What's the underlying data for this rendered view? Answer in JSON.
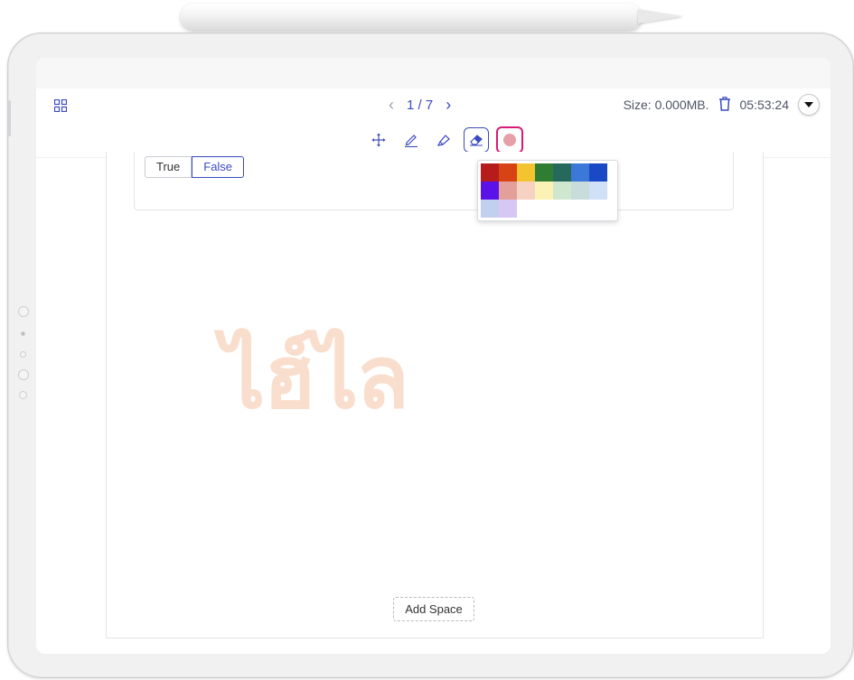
{
  "toolbar": {
    "page_indicator": "1 / 7",
    "size_text": "Size: 0.000MB.",
    "time": "05:53:24",
    "current_color": "#e8a0a8"
  },
  "icons": {
    "grid": "grid-icon",
    "prev": "chevron-left-icon",
    "next": "chevron-right-icon",
    "trash": "trash-icon",
    "dropdown": "caret-down-icon",
    "move": "move-icon",
    "pen": "pen-icon",
    "highlighter": "highlighter-icon",
    "eraser": "eraser-icon"
  },
  "palette": {
    "colors": [
      "#b71c1c",
      "#d84315",
      "#f4c430",
      "#2e7d32",
      "#26695c",
      "#3b78d8",
      "#1a49c5",
      "#5b12e8",
      "#e3a09a",
      "#f6d2c2",
      "#fdf2b5",
      "#cfe6cf",
      "#c9dcdc",
      "#cfe0f7",
      "#c3cfee",
      "#d7c7f4"
    ]
  },
  "question": {
    "true_label": "True",
    "false_label": "False",
    "selected": "False"
  },
  "watermark": "ไฮ์ไล",
  "add_space_label": "Add Space"
}
